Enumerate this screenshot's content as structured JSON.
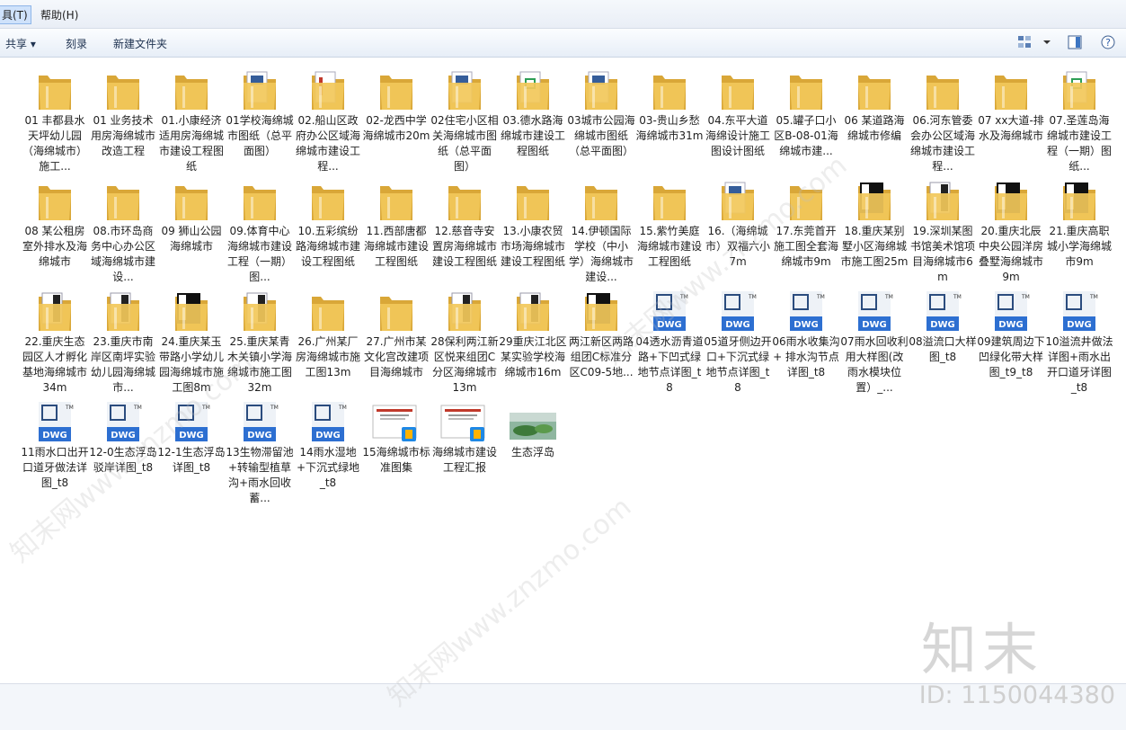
{
  "menubar": {
    "tools_label": "具(T)",
    "help_label": "帮助(H)"
  },
  "toolbar": {
    "share_label": "共享 ▾",
    "burn_label": "刻录",
    "new_folder_label": "新建文件夹"
  },
  "items": [
    {
      "label": "01 丰都县水天坪幼儿园（海绵城市）施工...",
      "type": "folder"
    },
    {
      "label": "01 业务技术用房海绵城市改造工程",
      "type": "folder"
    },
    {
      "label": "01.小康经济适用房海绵城市建设工程图纸",
      "type": "folder"
    },
    {
      "label": "01学校海绵城市图纸（总平面图）",
      "type": "folder-blue"
    },
    {
      "label": "02.船山区政府办公区域海绵城市建设工程...",
      "type": "folder-red"
    },
    {
      "label": "02-龙西中学海绵城市20m",
      "type": "folder"
    },
    {
      "label": "02住宅小区相关海绵城市图纸（总平面图）",
      "type": "folder-blue"
    },
    {
      "label": "03.德水路海绵城市建设工程图纸",
      "type": "folder-green"
    },
    {
      "label": "03城市公园海绵城市图纸（总平面图）",
      "type": "folder-blue"
    },
    {
      "label": "03-贵山乡愁海绵城市31m",
      "type": "folder"
    },
    {
      "label": "04.东平大道海绵设计施工图设计图纸",
      "type": "folder"
    },
    {
      "label": "05.罐子口小区B-08-01海绵城市建...",
      "type": "folder"
    },
    {
      "label": "06 某道路海绵城市修编",
      "type": "folder"
    },
    {
      "label": "06.河东管委会办公区域海绵城市建设工程...",
      "type": "folder"
    },
    {
      "label": "07 xx大道-排水及海绵城市",
      "type": "folder"
    },
    {
      "label": "07.圣莲岛海绵城市建设工程（一期）图纸...",
      "type": "folder-green"
    },
    {
      "label": "08 某公租房室外排水及海绵城市",
      "type": "folder"
    },
    {
      "label": "08.市环岛商务中心办公区域海绵城市建设...",
      "type": "folder"
    },
    {
      "label": "09 狮山公园海绵城市",
      "type": "folder"
    },
    {
      "label": "09.体育中心海绵城市建设工程（一期）图...",
      "type": "folder"
    },
    {
      "label": "10.五彩缤纷路海绵城市建设工程图纸",
      "type": "folder"
    },
    {
      "label": "11.西部唐都海绵城市建设工程图纸",
      "type": "folder"
    },
    {
      "label": "12.慈音寺安置房海绵城市建设工程图纸",
      "type": "folder"
    },
    {
      "label": "13.小康农贸市场海绵城市建设工程图纸",
      "type": "folder"
    },
    {
      "label": "14.伊顿国际学校（中小学）海绵城市建设...",
      "type": "folder"
    },
    {
      "label": "15.紫竹美庭海绵城市建设工程图纸",
      "type": "folder"
    },
    {
      "label": "16.（海绵城市）双福六小7m",
      "type": "folder-blue"
    },
    {
      "label": "17.东莞首开施工图全套海绵城市9m",
      "type": "folder"
    },
    {
      "label": "18.重庆某别墅小区海绵城市施工图25m",
      "type": "folder-dark"
    },
    {
      "label": "19.深圳某图书馆美术馆项目海绵城市6m",
      "type": "folder-white"
    },
    {
      "label": "20.重庆北辰中央公园洋房叠墅海绵城市9m",
      "type": "folder-dark"
    },
    {
      "label": "21.重庆高职城小学海绵城市9m",
      "type": "folder-dark"
    },
    {
      "label": "22.重庆生态园区人才孵化基地海绵城市34m",
      "type": "folder-white"
    },
    {
      "label": "23.重庆市南岸区南坪实验幼儿园海绵城市...",
      "type": "folder-white"
    },
    {
      "label": "24.重庆某玉带路小学幼儿园海绵城市施工图8m",
      "type": "folder-dark"
    },
    {
      "label": "25.重庆某青木关镇小学海绵城市施工图32m",
      "type": "folder-white"
    },
    {
      "label": "26.广州某厂房海绵城市施工图13m",
      "type": "folder"
    },
    {
      "label": "27.广州市某文化宫改建项目海绵城市",
      "type": "folder"
    },
    {
      "label": "28保利两江新区悦来组团C分区海绵城市13m",
      "type": "folder-white"
    },
    {
      "label": "29重庆江北区某实验学校海绵城市16m",
      "type": "folder-white"
    },
    {
      "label": "两江新区两路组团C标准分区C09-5地...",
      "type": "folder-dark"
    },
    {
      "label": "04透水沥青道路+下凹式绿地节点详图_t8",
      "type": "dwg"
    },
    {
      "label": "05道牙侧边开口+下沉式绿地节点详图_t8",
      "type": "dwg"
    },
    {
      "label": "06雨水收集沟+ 排水沟节点详图_t8",
      "type": "dwg"
    },
    {
      "label": "07雨水回收利用大样图(改雨水模块位置）_...",
      "type": "dwg"
    },
    {
      "label": "08溢流口大样图_t8",
      "type": "dwg"
    },
    {
      "label": "09建筑周边下凹绿化带大样图_t9_t8",
      "type": "dwg"
    },
    {
      "label": "10溢流井做法详图+雨水出开口道牙详图_t8",
      "type": "dwg"
    },
    {
      "label": "11雨水口出开口道牙做法详图_t8",
      "type": "dwg"
    },
    {
      "label": "12-0生态浮岛驳岸详图_t8",
      "type": "dwg"
    },
    {
      "label": "12-1生态浮岛详图_t8",
      "type": "dwg"
    },
    {
      "label": "13生物滞留池+转输型植草沟+雨水回收蓄...",
      "type": "dwg"
    },
    {
      "label": "14雨水湿地+下沉式绿地_t8",
      "type": "dwg"
    },
    {
      "label": "15海绵城市标准图集",
      "type": "pdf"
    },
    {
      "label": "海绵城市建设工程汇报",
      "type": "pdf"
    },
    {
      "label": "生态浮岛",
      "type": "photo"
    }
  ],
  "watermark": {
    "logo": "知末",
    "id": "ID: 1150044380",
    "diag": "知末网www.znzmo.com"
  },
  "colors": {
    "folder": "#f2c85a",
    "folder_dark": "#d9a738",
    "dwg_blue": "#2d6fd1",
    "dwg_gray": "#c9ced6"
  }
}
